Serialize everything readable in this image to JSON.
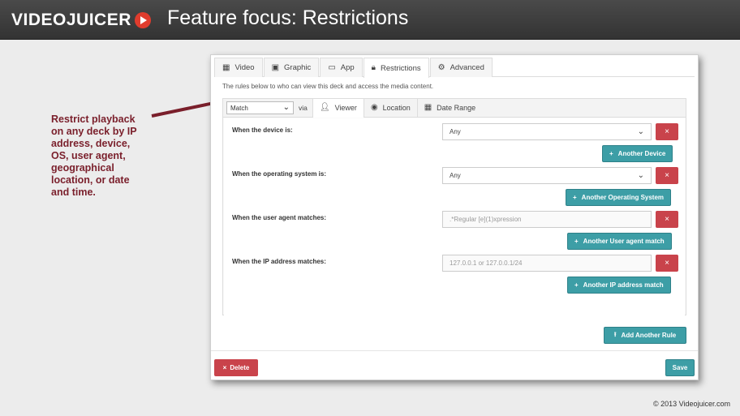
{
  "header": {
    "logo_text": "VIDEOJUICER",
    "title": "Feature focus: Restrictions"
  },
  "callout": {
    "text": "Restrict playback on any deck by IP address, device, OS, user agent, geographical location, or date and time."
  },
  "copyright": "© 2013 Videojuicer.com",
  "tabs": [
    {
      "label": "Video",
      "icon": "film-icon"
    },
    {
      "label": "Graphic",
      "icon": "image-icon"
    },
    {
      "label": "App",
      "icon": "monitor-icon"
    },
    {
      "label": "Restrictions",
      "icon": "lock-icon",
      "active": true
    },
    {
      "label": "Advanced",
      "icon": "gear-icon"
    }
  ],
  "intro": "The rules below  to who can view this deck and access the media content.",
  "match_select": "Match",
  "via": "via",
  "subtabs": [
    {
      "label": "Viewer",
      "icon": "user-icon",
      "active": true
    },
    {
      "label": "Location",
      "icon": "globe-icon"
    },
    {
      "label": "Date Range",
      "icon": "calendar-icon"
    }
  ],
  "rules": [
    {
      "label": "When the device is:",
      "value": "Any",
      "add_label": "Another Device"
    },
    {
      "label": "When the operating system is:",
      "value": "Any",
      "add_label": "Another Operating System"
    },
    {
      "label": "When the user agent matches:",
      "placeholder": ".*Regular [e](1)xpression",
      "add_label": "Another User agent match"
    },
    {
      "label": "When the IP address matches:",
      "placeholder": "127.0.0.1 or 127.0.0.1/24",
      "add_label": "Another IP address match"
    }
  ],
  "add_rule_label": "Add Another Rule",
  "delete_label": "Delete",
  "save_label": "Save",
  "colors": {
    "accent": "#3d9ea6",
    "danger": "#c9434b",
    "callout": "#7a1f2b",
    "header": "#3a3a3a"
  }
}
